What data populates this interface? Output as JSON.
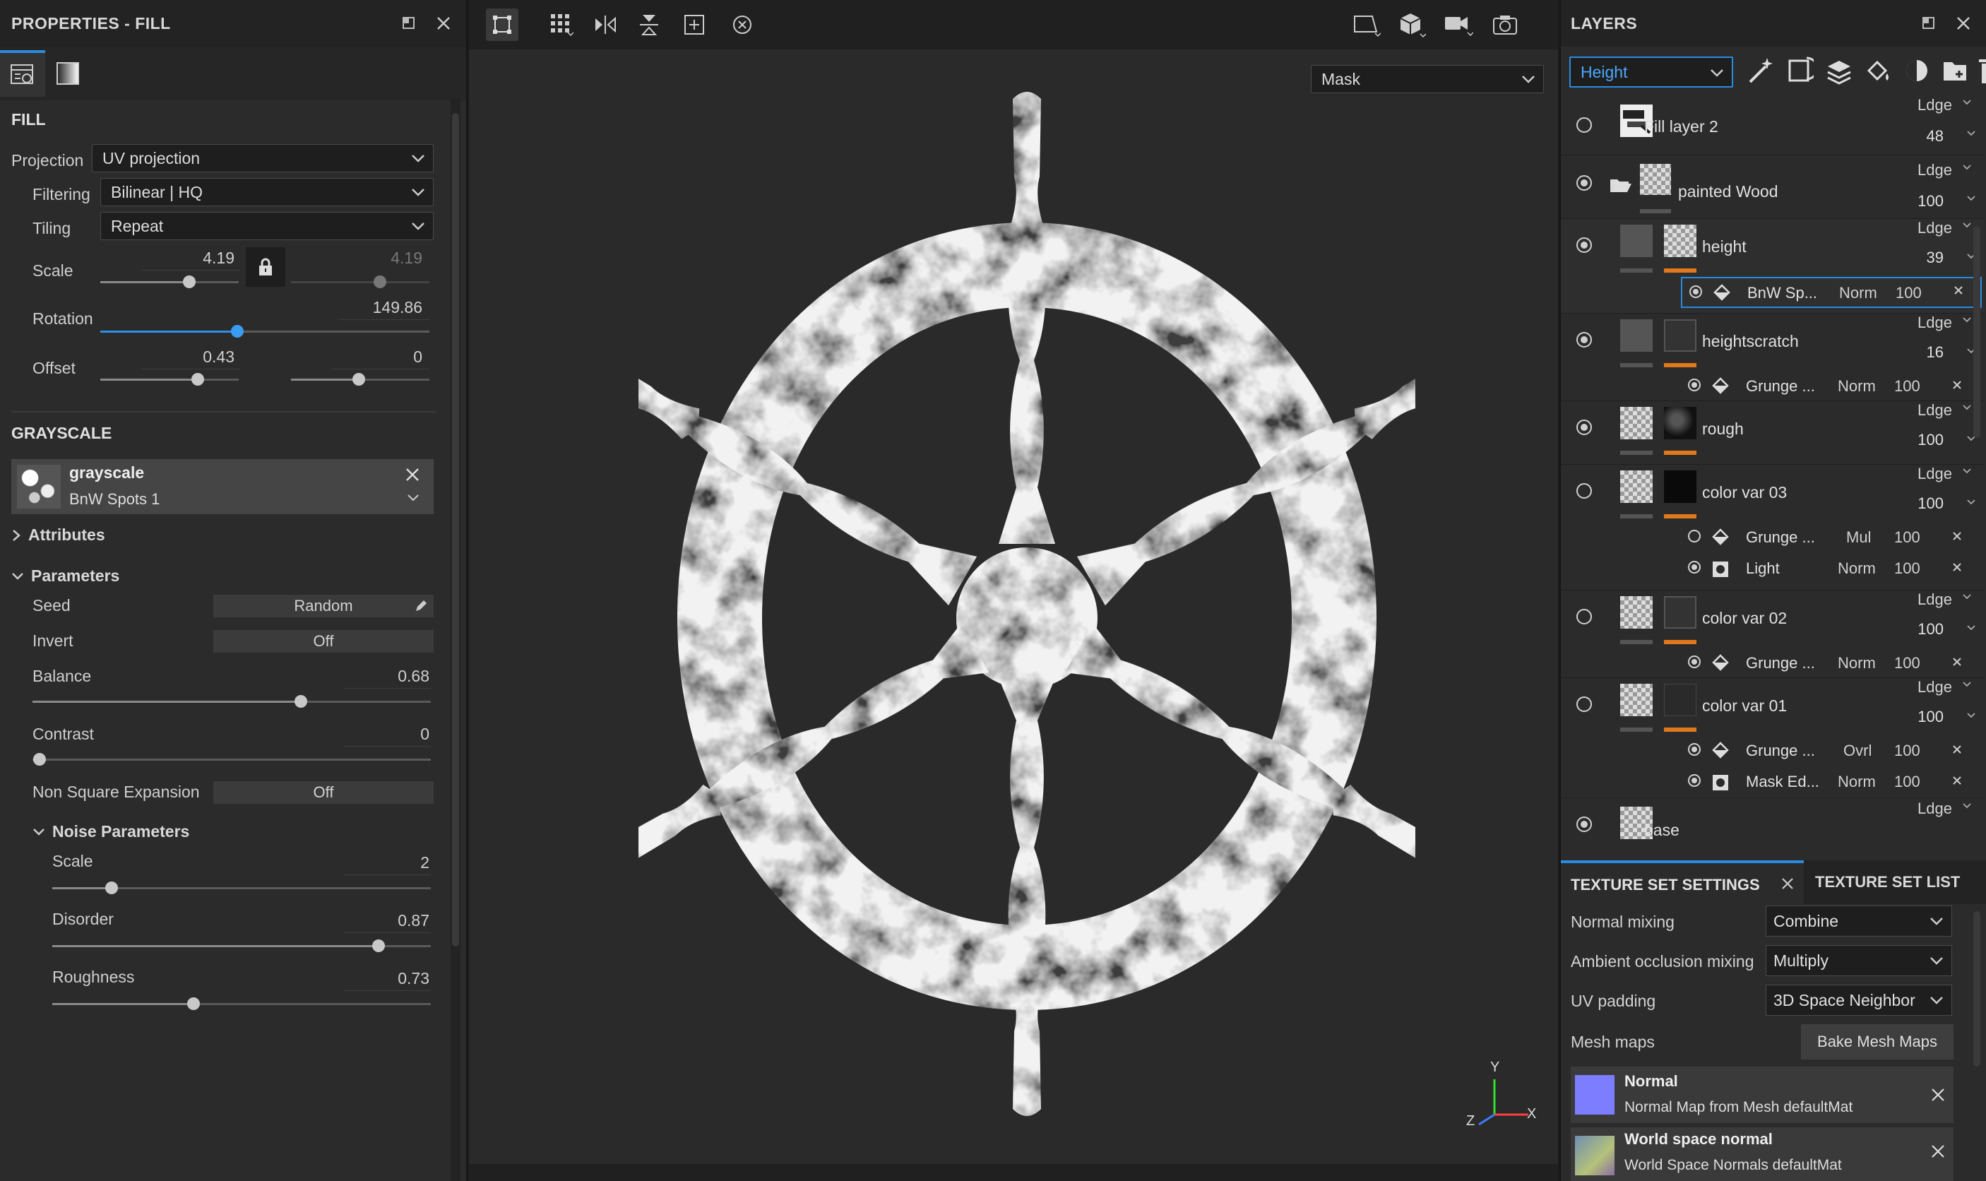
{
  "left_panel": {
    "title": "PROPERTIES - FILL",
    "fill": {
      "header": "FILL",
      "projection_label": "Projection",
      "projection_value": "UV projection",
      "filtering_label": "Filtering",
      "filtering_value": "Bilinear | HQ",
      "tiling_label": "Tiling",
      "tiling_value": "Repeat",
      "scale_label": "Scale",
      "scale_value": "4.19",
      "scale_value_locked": "4.19",
      "rotation_label": "Rotation",
      "rotation_value": "149.86",
      "offset_label": "Offset",
      "offset_x": "0.43",
      "offset_y": "0"
    },
    "grayscale": {
      "header": "GRAYSCALE",
      "resource_name": "grayscale",
      "resource_sub": "BnW Spots 1",
      "attributes_label": "Attributes",
      "parameters_label": "Parameters",
      "seed_label": "Seed",
      "seed_value": "Random",
      "invert_label": "Invert",
      "invert_value": "Off",
      "balance_label": "Balance",
      "balance_value": "0.68",
      "contrast_label": "Contrast",
      "contrast_value": "0",
      "nse_label": "Non Square Expansion",
      "nse_value": "Off",
      "noise_label": "Noise Parameters",
      "noise_scale_label": "Scale",
      "noise_scale_value": "2",
      "disorder_label": "Disorder",
      "disorder_value": "0.87",
      "roughness_label": "Roughness",
      "roughness_value": "0.73"
    }
  },
  "viewport": {
    "channel_dropdown": "Mask",
    "axis_y": "Y",
    "axis_x": "X",
    "axis_z": "Z"
  },
  "layers_panel": {
    "title": "LAYERS",
    "channel": "Height",
    "layers": [
      {
        "name": "Fill layer 2",
        "blend": "Ldge",
        "opacity": "48"
      },
      {
        "name": "painted Wood",
        "blend": "Ldge",
        "opacity": "100"
      },
      {
        "name": "height",
        "blend": "Ldge",
        "opacity": "39"
      },
      {
        "name": "heightscratch",
        "blend": "Ldge",
        "opacity": "16"
      },
      {
        "name": "rough",
        "blend": "Ldge",
        "opacity": "100"
      },
      {
        "name": "color var 03",
        "blend": "Ldge",
        "opacity": "100"
      },
      {
        "name": "color var 02",
        "blend": "Ldge",
        "opacity": "100"
      },
      {
        "name": "color var 01",
        "blend": "Ldge",
        "opacity": "100"
      },
      {
        "name": "base",
        "blend": "Ldge",
        "opacity": ""
      }
    ],
    "effects": {
      "height_fx": {
        "name": "BnW Sp...",
        "mode": "Norm",
        "opacity": "100"
      },
      "heightscratch_fx": {
        "name": "Grunge ...",
        "mode": "Norm",
        "opacity": "100"
      },
      "cv03_fx1": {
        "name": "Grunge ...",
        "mode": "Mul",
        "opacity": "100"
      },
      "cv03_fx2": {
        "name": "Light",
        "mode": "Norm",
        "opacity": "100"
      },
      "cv02_fx": {
        "name": "Grunge ...",
        "mode": "Norm",
        "opacity": "100"
      },
      "cv01_fx1": {
        "name": "Grunge ...",
        "mode": "Ovrl",
        "opacity": "100"
      },
      "cv01_fx2": {
        "name": "Mask Ed...",
        "mode": "Norm",
        "opacity": "100"
      }
    }
  },
  "texture_set": {
    "tab_settings": "TEXTURE SET SETTINGS",
    "tab_list": "TEXTURE SET LIST",
    "normal_mixing_label": "Normal mixing",
    "normal_mixing_value": "Combine",
    "ao_mixing_label": "Ambient occlusion mixing",
    "ao_mixing_value": "Multiply",
    "uv_padding_label": "UV padding",
    "uv_padding_value": "3D Space Neighbor",
    "mesh_maps_label": "Mesh maps",
    "bake_button": "Bake Mesh Maps",
    "maps": [
      {
        "title": "Normal",
        "desc": "Normal Map from Mesh defaultMat"
      },
      {
        "title": "World space normal",
        "desc": "World Space Normals defaultMat"
      }
    ]
  }
}
